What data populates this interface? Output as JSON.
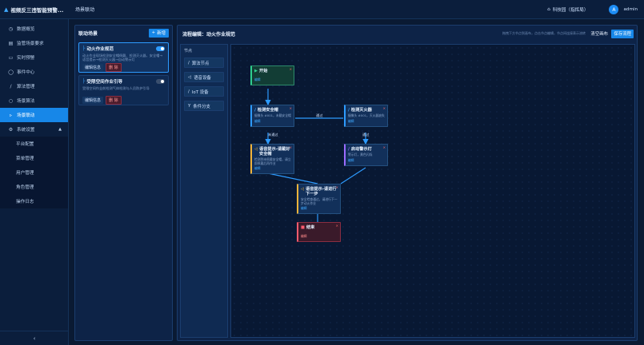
{
  "app": {
    "title": "视频反三违智能预警..."
  },
  "header": {
    "page_name": "场景联动",
    "park": "科技园（指挥局）",
    "avatar_letter": "A",
    "user": "admin"
  },
  "sidebar": {
    "items": [
      {
        "label": "数据概览",
        "icon": "clock-icon"
      },
      {
        "label": "监管场景要求",
        "icon": "document-icon"
      },
      {
        "label": "实时预警",
        "icon": "monitor-icon"
      },
      {
        "label": "事件中心",
        "icon": "bell-icon"
      },
      {
        "label": "算法管理",
        "icon": "link-icon"
      },
      {
        "label": "场景算法",
        "icon": "scan-icon"
      },
      {
        "label": "场景联动",
        "icon": "flow-icon"
      },
      {
        "label": "系统设置",
        "icon": "gear-icon"
      }
    ],
    "sub_items": [
      "平台配置",
      "菜单管理",
      "用户管理",
      "角色管理",
      "操作日志"
    ],
    "collapse_glyph": "‹"
  },
  "scene_panel": {
    "title": "联动场景",
    "add_label": "新增",
    "scenes": [
      {
        "name": "动火作业规范",
        "desc": "动火作业现场检测安全帽佩戴、检测灭火器，安全帽→语音提示→检测灭火器→自动警示灯",
        "edit": "编辑信息",
        "delete": "删 除"
      },
      {
        "name": "受限空间作业引导",
        "desc": "受限空间作业前检测气体检测与人员防护引导",
        "edit": "编辑信息",
        "delete": "删 除"
      }
    ]
  },
  "editor": {
    "title": "流程编辑：动火作业规范",
    "hint": "拖拽下方节点到画布，点击节点编辑，节点间连接表示流转",
    "clear_label": "清空画布",
    "save_label": "保存流程",
    "palette_title": "节点",
    "palette": [
      {
        "label": "算法节点",
        "icon": "link-icon"
      },
      {
        "label": "语音设备",
        "icon": "speaker-icon"
      },
      {
        "label": "IoT 设备",
        "icon": "link-icon"
      },
      {
        "label": "条件分支",
        "icon": "branch-icon"
      }
    ],
    "nodes": {
      "start": {
        "title": "开始",
        "edit": "编辑"
      },
      "helmet": {
        "title": "检测安全帽",
        "desc": "摄像头 #001，未戴安全帽",
        "edit": "编辑"
      },
      "extinguisher": {
        "title": "检测灭火器",
        "desc": "摄像头 #001，灭火器缺失",
        "edit": "编辑"
      },
      "voice1": {
        "title": "语音提示-请戴好安全帽",
        "desc": "检测到未佩戴安全帽，请立即佩戴后再作业",
        "edit": "编辑"
      },
      "alarm": {
        "title": "启动警示灯",
        "desc": "警示灯，黄色闪烁",
        "edit": "编辑"
      },
      "voice2": {
        "title": "语音提示-请进行下一步",
        "desc": "安全检查通过，请进行下一步动火作业",
        "edit": "编辑"
      },
      "end": {
        "title": "结束",
        "edit": "编辑"
      }
    },
    "edge_labels": {
      "pass1": "通过",
      "fail": "未通过",
      "pass2": "通过"
    }
  }
}
